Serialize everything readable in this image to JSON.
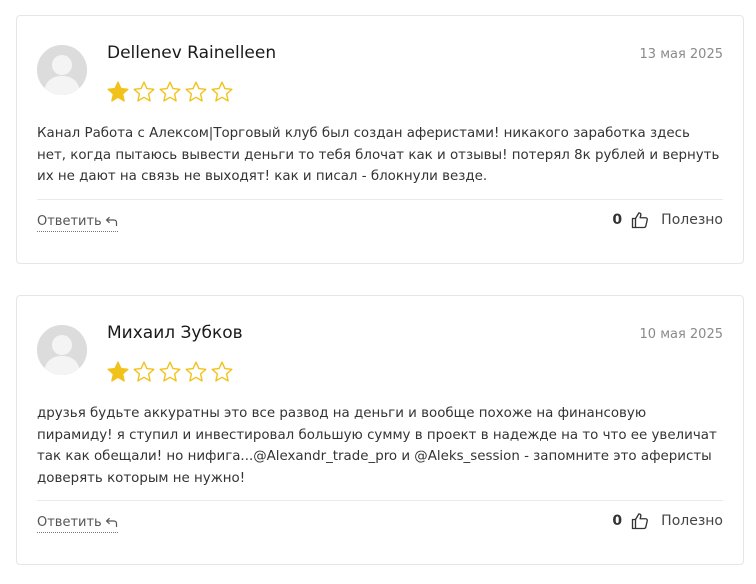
{
  "colors": {
    "star_filled": "#f2c21c",
    "star_empty_stroke": "#f2c21c",
    "card_border": "#e6e6e6"
  },
  "reviews": [
    {
      "author": "Dellenev Rainelleen",
      "date": "13 мая 2025",
      "rating": 1,
      "max_rating": 5,
      "text": "Канал Работа с Алексом|Торговый клуб был создан аферистами! никакого заработка здесь нет, когда пытаюсь вывести деньги то тебя блочат как и отзывы! потерял 8к рублей и вернуть их не дают на связь не выходят! как и писал - блокнули везде.",
      "reply_label": "Ответить",
      "reply_icon": "reply-arrow-icon",
      "useful_count": "0",
      "useful_label": "Полезно",
      "useful_icon": "thumbs-up-icon"
    },
    {
      "author": "Михаил Зубков",
      "date": "10 мая 2025",
      "rating": 1,
      "max_rating": 5,
      "text": "друзья будьте аккуратны это все развод на деньги и вообще похоже на финансовую пирамиду! я ступил и инвестировал большую сумму в проект в надежде на то что ее увеличат так как обещали! но нифига...@Alexandr_trade_pro и @Aleks_session - запомните это аферисты доверять которым не нужно!",
      "reply_label": "Ответить",
      "reply_icon": "reply-arrow-icon",
      "useful_count": "0",
      "useful_label": "Полезно",
      "useful_icon": "thumbs-up-icon"
    }
  ]
}
